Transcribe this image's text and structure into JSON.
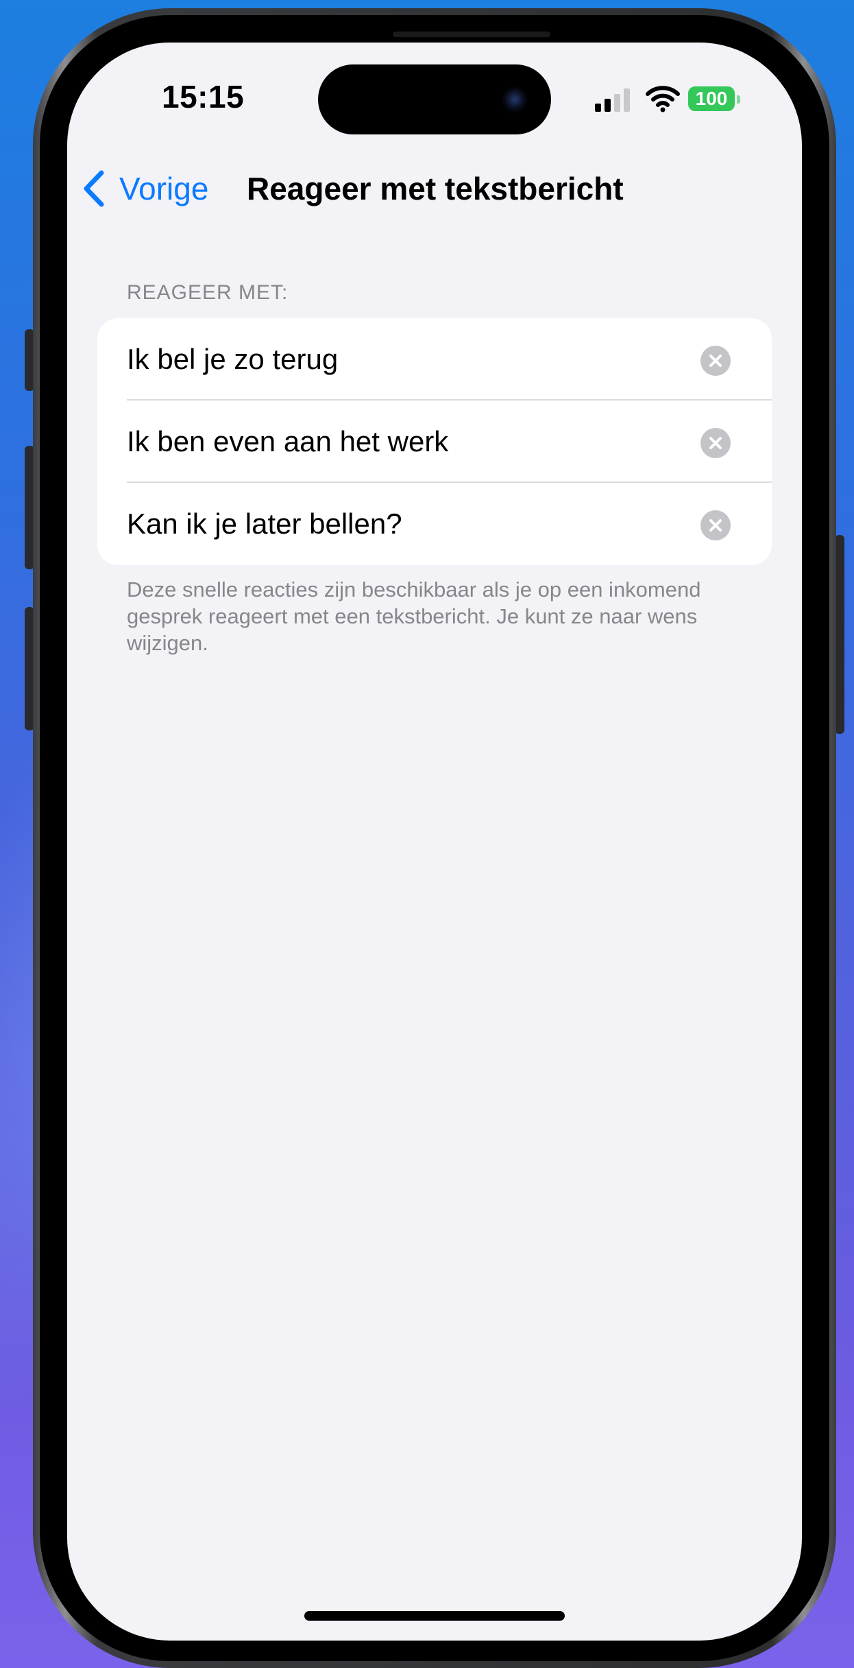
{
  "status_bar": {
    "time": "15:15",
    "battery": "100",
    "signal_bars": 2,
    "signal_total": 4
  },
  "nav": {
    "back_label": "Vorige",
    "title": "Reageer met tekstbericht"
  },
  "section": {
    "header": "REAGEER MET:",
    "items": [
      {
        "label": "Ik bel je zo terug"
      },
      {
        "label": "Ik ben even aan het werk"
      },
      {
        "label": "Kan ik je later bellen?"
      }
    ],
    "footer": "Deze snelle reacties zijn beschikbaar als je op een inkomend gesprek reageert met een tekstbericht. Je kunt ze naar wens wijzigen."
  },
  "colors": {
    "accent": "#0a7aff",
    "battery": "#34c759",
    "background": "#f2f2f7",
    "secondary_text": "#86868b"
  }
}
